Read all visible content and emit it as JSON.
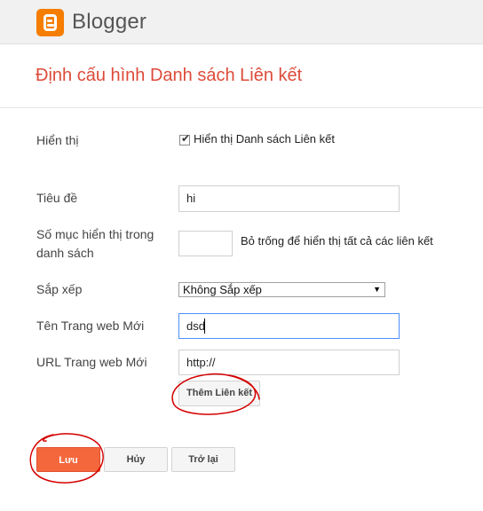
{
  "header": {
    "brand": "Blogger",
    "logo_icon": "blogger-logo-icon"
  },
  "page": {
    "title": "Định cấu hình Danh sách Liên kết"
  },
  "form": {
    "display": {
      "label": "Hiển thị",
      "checkbox_label": "Hiển thị Danh sách Liên kết",
      "checked": true
    },
    "title": {
      "label": "Tiêu đề",
      "value": "hi"
    },
    "count": {
      "label_line1": "Số mục hiển thị trong",
      "label_line2": "danh sách",
      "value": "",
      "hint": "Bỏ trống để hiển thị tất cả các liên kết"
    },
    "sort": {
      "label": "Sắp xếp",
      "selected": "Không Sắp xếp"
    },
    "new_site_name": {
      "label": "Tên Trang web Mới",
      "value": "dsd"
    },
    "new_site_url": {
      "label": "URL Trang web Mới",
      "value": "http://"
    },
    "add_link_button": "Thêm Liên kết"
  },
  "actions": {
    "save": "Lưu",
    "cancel": "Hủy",
    "revert": "Trở lại"
  },
  "colors": {
    "accent": "#dd4b39",
    "save_button": "#f4673d",
    "brand_orange": "#f57d00",
    "annotation": "#d40000"
  }
}
